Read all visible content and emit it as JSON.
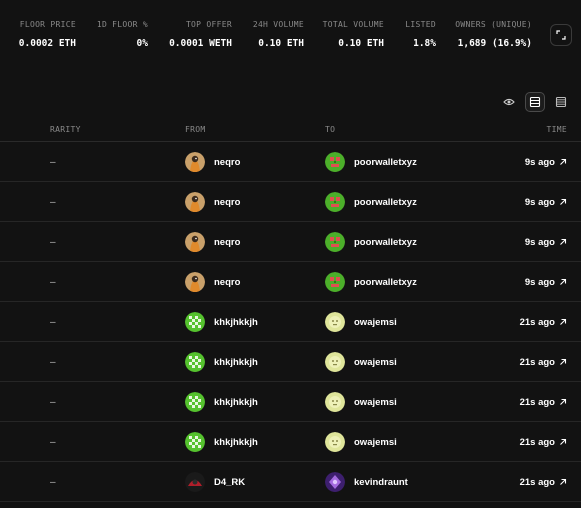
{
  "stats": [
    {
      "label": "FLOOR PRICE",
      "value": "0.0002 ETH"
    },
    {
      "label": "1D FLOOR %",
      "value": "0%"
    },
    {
      "label": "TOP OFFER",
      "value": "0.0001 WETH"
    },
    {
      "label": "24H VOLUME",
      "value": "0.10 ETH"
    },
    {
      "label": "TOTAL VOLUME",
      "value": "0.10 ETH"
    },
    {
      "label": "LISTED",
      "value": "1.8%"
    },
    {
      "label": "OWNERS (UNIQUE)",
      "value": "1,689 (16.9%)"
    }
  ],
  "table": {
    "headers": {
      "rarity": "RARITY",
      "from": "FROM",
      "to": "TO",
      "time": "TIME"
    },
    "rows": [
      {
        "rarity": "–",
        "from": "neqro",
        "from_avatar": "orange-bird-avatar",
        "to": "poorwalletxyz",
        "to_avatar": "green-pixel-avatar",
        "time": "9s ago"
      },
      {
        "rarity": "–",
        "from": "neqro",
        "from_avatar": "orange-bird-avatar",
        "to": "poorwalletxyz",
        "to_avatar": "green-pixel-avatar",
        "time": "9s ago"
      },
      {
        "rarity": "–",
        "from": "neqro",
        "from_avatar": "orange-bird-avatar",
        "to": "poorwalletxyz",
        "to_avatar": "green-pixel-avatar",
        "time": "9s ago"
      },
      {
        "rarity": "–",
        "from": "neqro",
        "from_avatar": "orange-bird-avatar",
        "to": "poorwalletxyz",
        "to_avatar": "green-pixel-avatar",
        "time": "9s ago"
      },
      {
        "rarity": "–",
        "from": "khkjhkkjh",
        "from_avatar": "green-checker-avatar",
        "to": "owajemsi",
        "to_avatar": "yellow-face-avatar",
        "time": "21s ago"
      },
      {
        "rarity": "–",
        "from": "khkjhkkjh",
        "from_avatar": "green-checker-avatar",
        "to": "owajemsi",
        "to_avatar": "yellow-face-avatar",
        "time": "21s ago"
      },
      {
        "rarity": "–",
        "from": "khkjhkkjh",
        "from_avatar": "green-checker-avatar",
        "to": "owajemsi",
        "to_avatar": "yellow-face-avatar",
        "time": "21s ago"
      },
      {
        "rarity": "–",
        "from": "khkjhkkjh",
        "from_avatar": "green-checker-avatar",
        "to": "owajemsi",
        "to_avatar": "yellow-face-avatar",
        "time": "21s ago"
      },
      {
        "rarity": "–",
        "from": "D4_RK",
        "from_avatar": "dark-red-avatar",
        "to": "kevindraunt",
        "to_avatar": "purple-avatar",
        "time": "21s ago"
      }
    ]
  },
  "icons": {
    "expand": "expand-icon",
    "eye": "eye-icon",
    "list_view": "list-view-icon",
    "compact_view": "compact-list-icon",
    "external_link": "arrow-up-right-icon"
  },
  "colors": {
    "background": "#121212",
    "text": "#ffffff",
    "muted": "#8a8a8a",
    "divider": "#262626"
  }
}
